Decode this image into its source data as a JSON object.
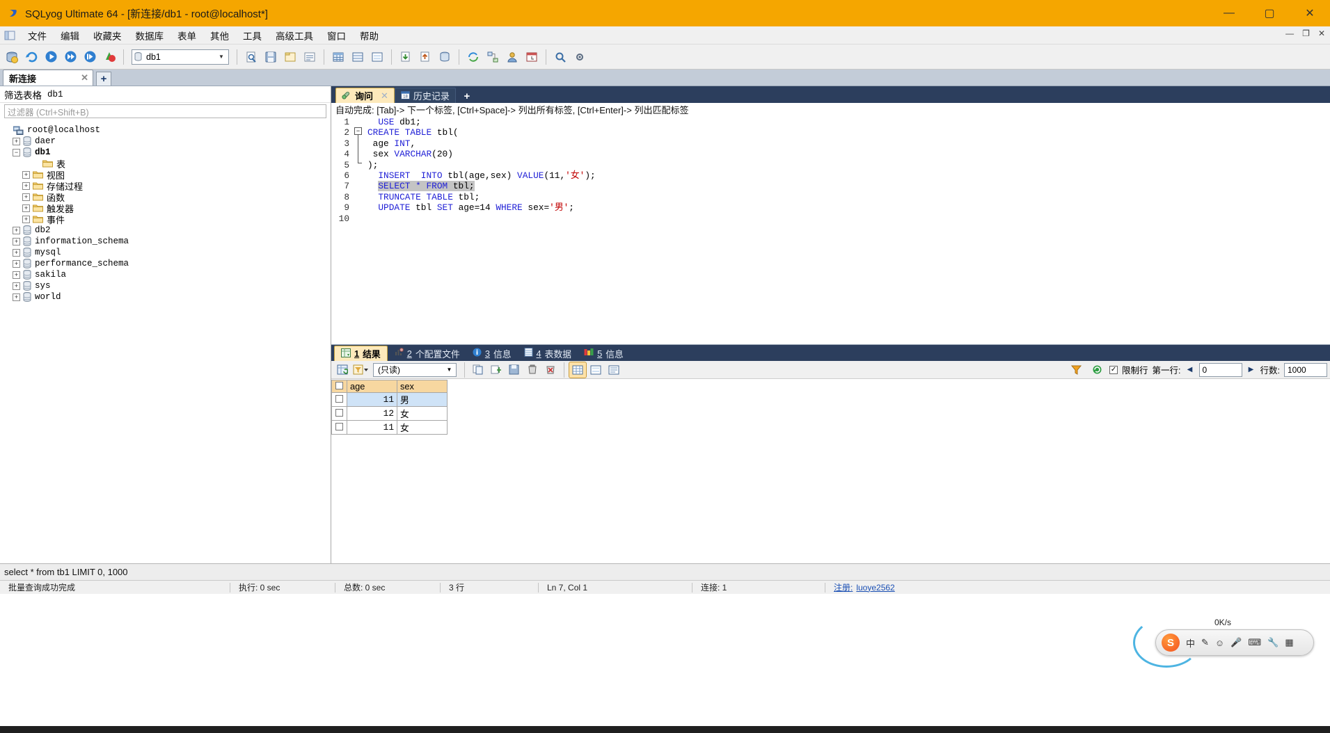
{
  "window": {
    "title": "SQLyog Ultimate 64 - [新连接/db1 - root@localhost*]",
    "app_icon": "sqlyog-icon",
    "minimize": "—",
    "maximize": "▢",
    "close": "✕"
  },
  "menubar": {
    "items": [
      {
        "label": "文件",
        "name": "menu-file"
      },
      {
        "label": "编辑",
        "name": "menu-edit"
      },
      {
        "label": "收藏夹",
        "name": "menu-favorites"
      },
      {
        "label": "数据库",
        "name": "menu-database"
      },
      {
        "label": "表单",
        "name": "menu-form"
      },
      {
        "label": "其他",
        "name": "menu-other"
      },
      {
        "label": "工具",
        "name": "menu-tools"
      },
      {
        "label": "高级工具",
        "name": "menu-advanced-tools"
      },
      {
        "label": "窗口",
        "name": "menu-window"
      },
      {
        "label": "帮助",
        "name": "menu-help"
      }
    ],
    "mdi_minimize": "—",
    "mdi_restore": "❐",
    "mdi_close": "✕"
  },
  "toolbar": {
    "db_selector_value": "db1",
    "db_selector_arrow": "▼"
  },
  "connection_tabs": {
    "tabs": [
      {
        "label": "新连接",
        "close": "✕"
      }
    ],
    "add_label": "+"
  },
  "sidebar": {
    "filter_label": "筛选表格",
    "filter_db": "db1",
    "filter_placeholder": "过滤器 (Ctrl+Shift+B)",
    "tree": [
      {
        "label": "root@localhost",
        "icon": "server-icon",
        "indent": 0,
        "expander": "",
        "bold": false,
        "cjk": false
      },
      {
        "label": "daer",
        "icon": "database-icon",
        "indent": 1,
        "expander": "+",
        "bold": false,
        "cjk": false
      },
      {
        "label": "db1",
        "icon": "database-icon",
        "indent": 1,
        "expander": "−",
        "bold": true,
        "cjk": false
      },
      {
        "label": "表",
        "icon": "folder-icon",
        "indent": 3,
        "expander": "",
        "bold": false,
        "cjk": true
      },
      {
        "label": "视图",
        "icon": "folder-icon",
        "indent": 2,
        "expander": "+",
        "bold": false,
        "cjk": true
      },
      {
        "label": "存储过程",
        "icon": "folder-icon",
        "indent": 2,
        "expander": "+",
        "bold": false,
        "cjk": true
      },
      {
        "label": "函数",
        "icon": "folder-icon",
        "indent": 2,
        "expander": "+",
        "bold": false,
        "cjk": true
      },
      {
        "label": "触发器",
        "icon": "folder-icon",
        "indent": 2,
        "expander": "+",
        "bold": false,
        "cjk": true
      },
      {
        "label": "事件",
        "icon": "folder-icon",
        "indent": 2,
        "expander": "+",
        "bold": false,
        "cjk": true
      },
      {
        "label": "db2",
        "icon": "database-icon",
        "indent": 1,
        "expander": "+",
        "bold": false,
        "cjk": false
      },
      {
        "label": "information_schema",
        "icon": "database-icon",
        "indent": 1,
        "expander": "+",
        "bold": false,
        "cjk": false
      },
      {
        "label": "mysql",
        "icon": "database-icon",
        "indent": 1,
        "expander": "+",
        "bold": false,
        "cjk": false
      },
      {
        "label": "performance_schema",
        "icon": "database-icon",
        "indent": 1,
        "expander": "+",
        "bold": false,
        "cjk": false
      },
      {
        "label": "sakila",
        "icon": "database-icon",
        "indent": 1,
        "expander": "+",
        "bold": false,
        "cjk": false
      },
      {
        "label": "sys",
        "icon": "database-icon",
        "indent": 1,
        "expander": "+",
        "bold": false,
        "cjk": false
      },
      {
        "label": "world",
        "icon": "database-icon",
        "indent": 1,
        "expander": "+",
        "bold": false,
        "cjk": false
      }
    ]
  },
  "query_tabs": {
    "tabs": [
      {
        "label": "询问",
        "active": true,
        "close": "✕",
        "icon": "query-icon"
      },
      {
        "label": "历史记录",
        "active": false,
        "icon": "history-icon"
      }
    ],
    "add_label": "+"
  },
  "editor": {
    "autocomplete_hint": "自动完成: [Tab]-> 下一个标签, [Ctrl+Space]-> 列出所有标签, [Ctrl+Enter]-> 列出匹配标签",
    "line_numbers": [
      "1",
      "2",
      "3",
      "4",
      "5",
      "6",
      "7",
      "8",
      "9",
      "10"
    ],
    "lines": [
      {
        "n": 1,
        "parts": [
          {
            "t": "  ",
            "c": ""
          },
          {
            "t": "USE",
            "c": "kw"
          },
          {
            "t": " db1;",
            "c": ""
          }
        ]
      },
      {
        "n": 2,
        "parts": [
          {
            "t": "CREATE TABLE",
            "c": "kw"
          },
          {
            "t": " tbl(",
            "c": ""
          }
        ]
      },
      {
        "n": 3,
        "parts": [
          {
            "t": " age ",
            "c": ""
          },
          {
            "t": "INT",
            "c": "kw"
          },
          {
            "t": ",",
            "c": ""
          }
        ]
      },
      {
        "n": 4,
        "parts": [
          {
            "t": " sex ",
            "c": ""
          },
          {
            "t": "VARCHAR",
            "c": "kw"
          },
          {
            "t": "(20)",
            "c": ""
          }
        ]
      },
      {
        "n": 5,
        "parts": [
          {
            "t": ");",
            "c": ""
          }
        ]
      },
      {
        "n": 6,
        "parts": [
          {
            "t": "  ",
            "c": ""
          },
          {
            "t": "INSERT  INTO",
            "c": "kw"
          },
          {
            "t": " tbl(age,sex) ",
            "c": ""
          },
          {
            "t": "VALUE",
            "c": "kw"
          },
          {
            "t": "(11,",
            "c": ""
          },
          {
            "t": "'女'",
            "c": "str"
          },
          {
            "t": ");",
            "c": ""
          }
        ]
      },
      {
        "n": 7,
        "parts": [
          {
            "t": "  ",
            "c": ""
          },
          {
            "t": "SELECT * FROM",
            "c": "kw sel"
          },
          {
            "t": " tbl;",
            "c": "sel"
          }
        ]
      },
      {
        "n": 8,
        "parts": [
          {
            "t": "  ",
            "c": ""
          },
          {
            "t": "TRUNCATE TABLE",
            "c": "kw"
          },
          {
            "t": " tbl;",
            "c": ""
          }
        ]
      },
      {
        "n": 9,
        "parts": [
          {
            "t": "  ",
            "c": ""
          },
          {
            "t": "UPDATE",
            "c": "kw"
          },
          {
            "t": " tbl ",
            "c": ""
          },
          {
            "t": "SET",
            "c": "kw"
          },
          {
            "t": " age=14 ",
            "c": ""
          },
          {
            "t": "WHERE",
            "c": "kw"
          },
          {
            "t": " sex=",
            "c": ""
          },
          {
            "t": "'男'",
            "c": "str"
          },
          {
            "t": ";",
            "c": ""
          }
        ]
      },
      {
        "n": 10,
        "parts": [
          {
            "t": "",
            "c": ""
          }
        ]
      }
    ]
  },
  "result_tabs": [
    {
      "num": "1",
      "label": "结果",
      "active": true,
      "icon": "grid-icon"
    },
    {
      "num": "2",
      "label": "个配置文件",
      "active": false,
      "icon": "profile-icon"
    },
    {
      "num": "3",
      "label": "信息",
      "active": false,
      "icon": "info-icon"
    },
    {
      "num": "4",
      "label": "表数据",
      "active": false,
      "icon": "table-icon"
    },
    {
      "num": "5",
      "label": "信息",
      "active": false,
      "icon": "messages-icon"
    }
  ],
  "result_toolbar": {
    "mode_value": "(只读)",
    "mode_arrow": "▼",
    "limit_checkbox_label": "限制行",
    "limit_checked": "✓",
    "first_row_label": "第一行:",
    "first_row_value": "0",
    "rows_label": "行数:",
    "rows_value": "1000",
    "prev_arrow": "◀",
    "next_arrow": "▶"
  },
  "grid": {
    "columns": [
      "age",
      "sex"
    ],
    "rows": [
      {
        "age": "11",
        "sex": "男",
        "selected": true
      },
      {
        "age": "12",
        "sex": "女",
        "selected": false
      },
      {
        "age": "11",
        "sex": "女",
        "selected": false
      }
    ]
  },
  "query_echo": "select * from tb1 LIMIT 0, 1000",
  "statusbar": {
    "message": "批量查询成功完成",
    "exec_time": "执行: 0 sec",
    "total_time": "总数: 0 sec",
    "rows": "3 行",
    "cursor": "Ln 7, Col 1",
    "connections": "连接: 1",
    "register_label": "注册:",
    "register_user": "luoye2562"
  },
  "ime": {
    "lang": "中",
    "speed": "0K/s",
    "items": [
      "中",
      "✎",
      "☺",
      "🎤",
      "⌨",
      "🅰",
      "🔧",
      "▦"
    ]
  },
  "colors": {
    "title_bg": "#f5a600",
    "tab_dark": "#2c3e5d",
    "tab_active": "#fde9bb",
    "grid_header": "#f7d7a0",
    "keyword": "#2121d6",
    "string": "#c00000",
    "selection": "#c4c4c4"
  }
}
